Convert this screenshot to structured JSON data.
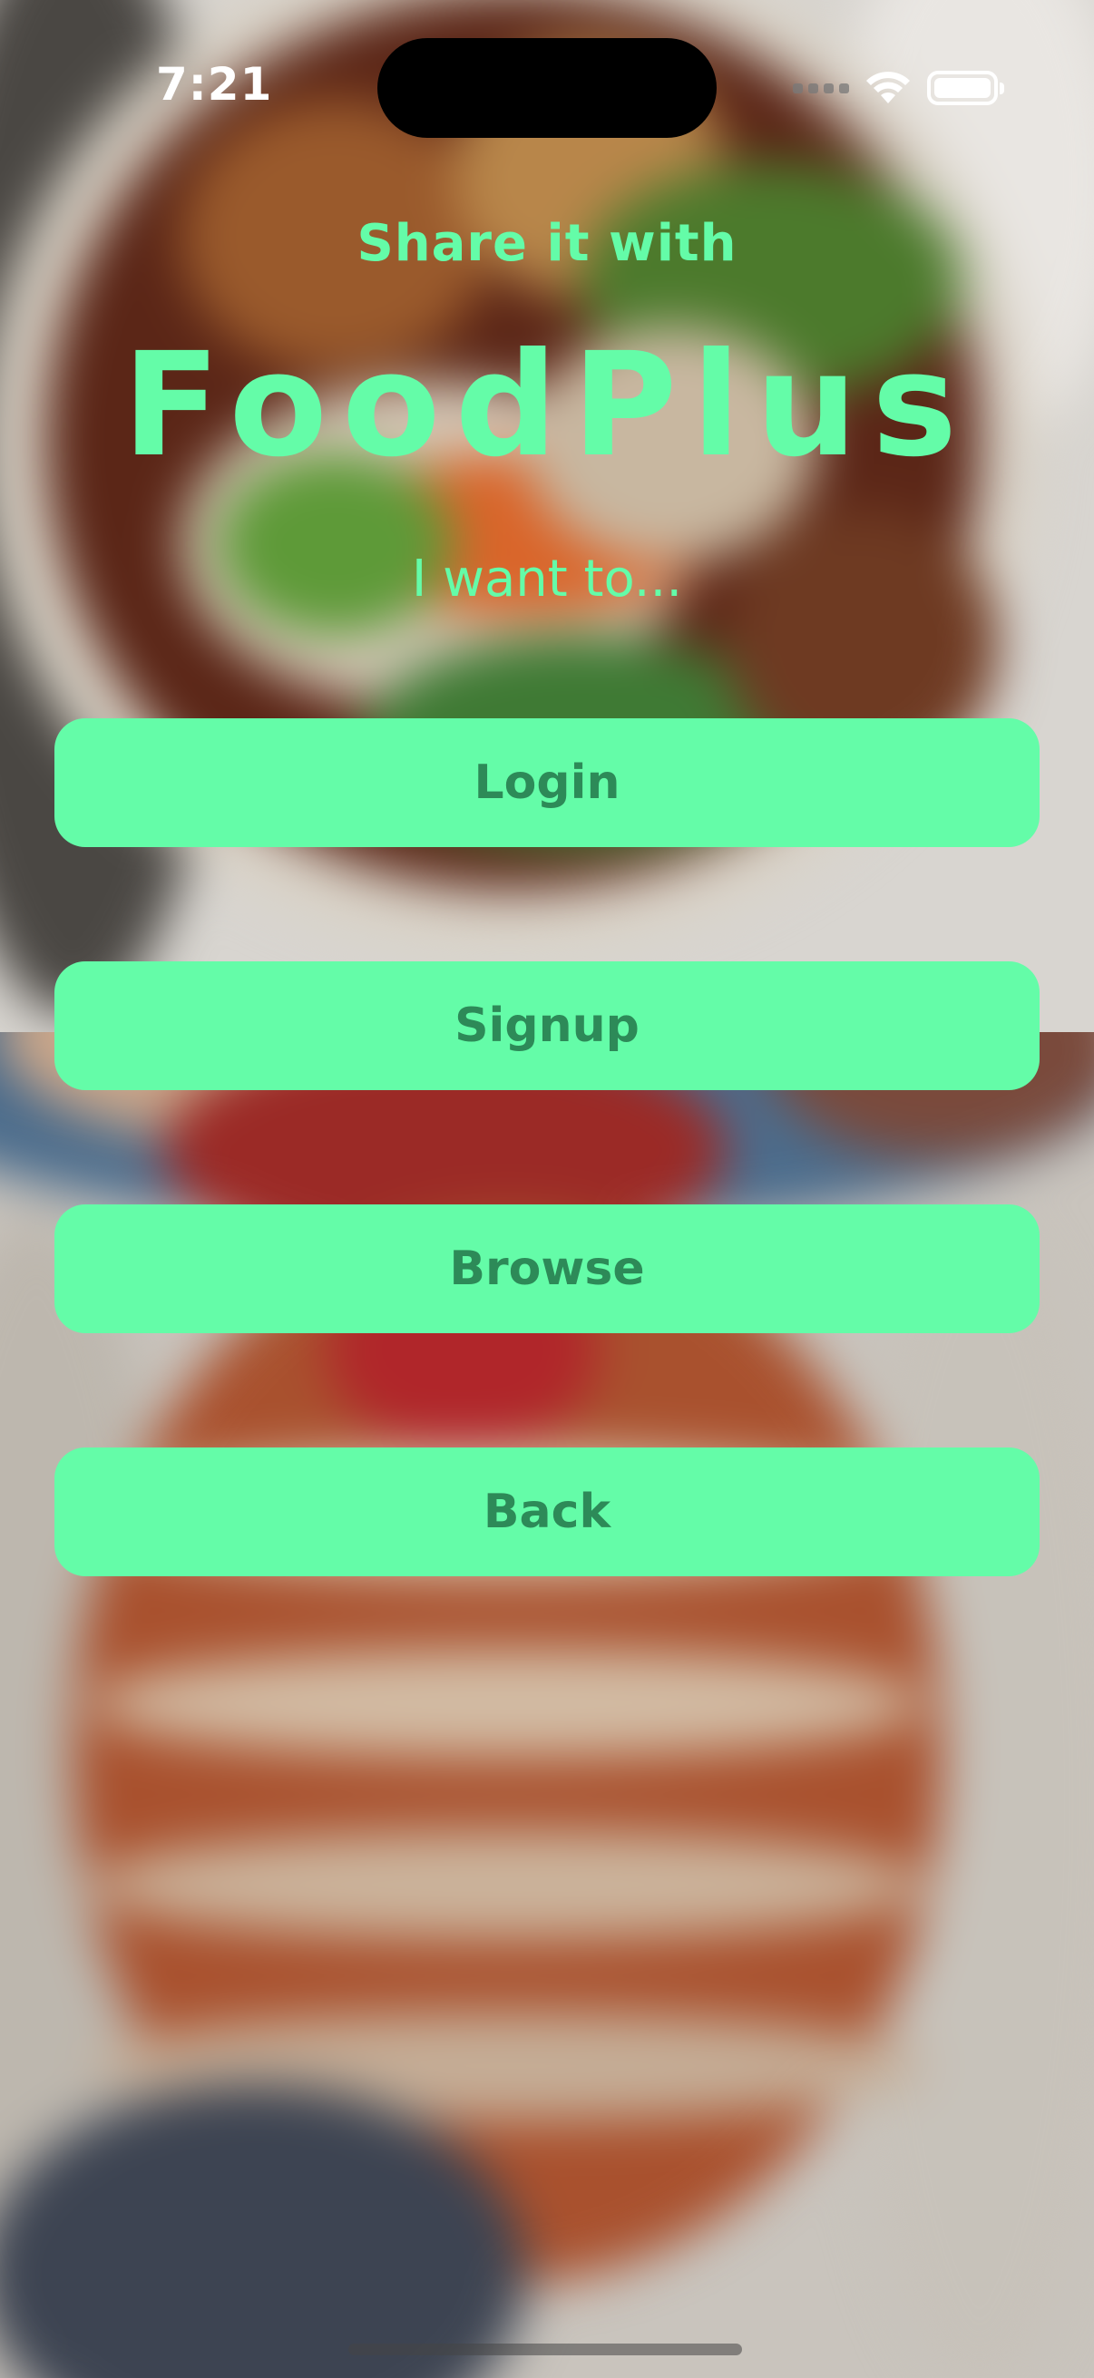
{
  "status_bar": {
    "time": "7:21"
  },
  "header": {
    "tagline": "Share it with",
    "brand": "FoodPlus",
    "prompt": "I want to..."
  },
  "actions": [
    {
      "label": "Login"
    },
    {
      "label": "Signup"
    },
    {
      "label": "Browse"
    },
    {
      "label": "Back"
    }
  ],
  "icons": {
    "signal": "cellular-signal-icon",
    "wifi": "wifi-icon",
    "battery": "battery-icon"
  },
  "colors": {
    "accent": "#64fca8",
    "button_text": "#2d8a58",
    "status_text": "#ffffff"
  }
}
